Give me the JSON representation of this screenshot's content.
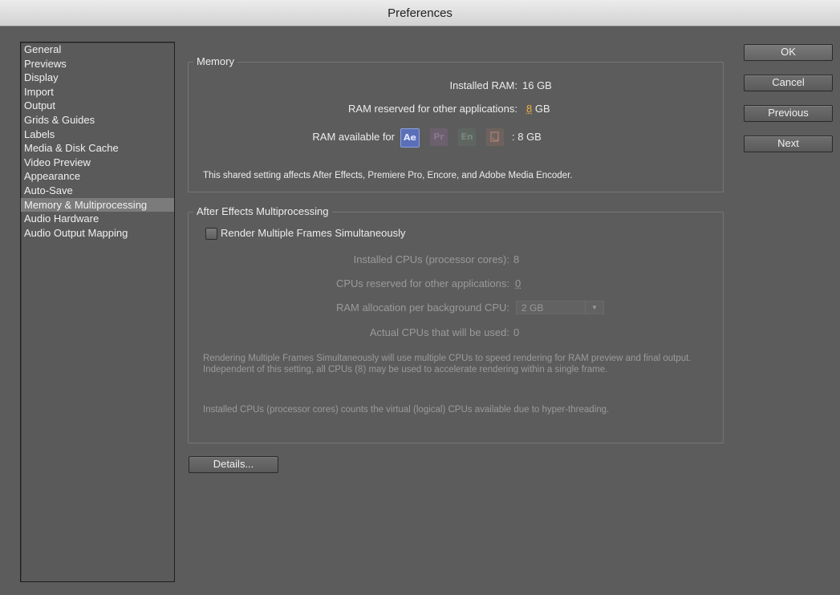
{
  "window": {
    "title": "Preferences"
  },
  "sidebar": {
    "items": [
      {
        "label": "General"
      },
      {
        "label": "Previews"
      },
      {
        "label": "Display"
      },
      {
        "label": "Import"
      },
      {
        "label": "Output"
      },
      {
        "label": "Grids & Guides"
      },
      {
        "label": "Labels"
      },
      {
        "label": "Media & Disk Cache"
      },
      {
        "label": "Video Preview"
      },
      {
        "label": "Appearance"
      },
      {
        "label": "Auto-Save"
      },
      {
        "label": "Memory & Multiprocessing"
      },
      {
        "label": "Audio Hardware"
      },
      {
        "label": "Audio Output Mapping"
      }
    ],
    "selected": "Memory & Multiprocessing"
  },
  "memory": {
    "legend": "Memory",
    "installed_ram_label": "Installed RAM:",
    "installed_ram_value": "16 GB",
    "reserved_label": "RAM reserved for other applications:",
    "reserved_value": "8",
    "reserved_unit": "GB",
    "available_label": "RAM available for",
    "apps": [
      {
        "text": "Ae",
        "name": "after-effects-icon"
      },
      {
        "text": "Pr",
        "name": "premiere-pro-icon"
      },
      {
        "text": "En",
        "name": "encore-icon"
      },
      {
        "text": "Me",
        "name": "media-encoder-icon"
      }
    ],
    "available_value": ": 8 GB",
    "note": "This shared setting affects After Effects, Premiere Pro, Encore, and Adobe Media Encoder."
  },
  "multiprocessing": {
    "legend": "After Effects Multiprocessing",
    "checkbox_label": "Render Multiple Frames Simultaneously",
    "checkbox_checked": false,
    "installed_cpus_label": "Installed CPUs (processor cores):",
    "installed_cpus_value": "8",
    "reserved_cpus_label": "CPUs reserved for other applications:",
    "reserved_cpus_value": "0",
    "ram_alloc_label": "RAM allocation per background CPU:",
    "ram_alloc_value": "2 GB",
    "actual_cpus_label": "Actual CPUs that will be used:",
    "actual_cpus_value": "0",
    "note1": "Rendering Multiple Frames Simultaneously will use multiple CPUs to speed rendering for RAM preview and final output. Independent of this setting, all CPUs (8) may be used to accelerate rendering within a single frame.",
    "note2": "Installed CPUs (processor cores) counts the virtual (logical) CPUs available due to hyper-threading."
  },
  "buttons": {
    "details": "Details...",
    "ok": "OK",
    "cancel": "Cancel",
    "previous": "Previous",
    "next": "Next"
  },
  "colors": {
    "background": "#5c5c5c",
    "selected_item": "#7b7b7b",
    "accent_orange": "#f0b040",
    "ae_icon": "#5a6fb8"
  }
}
